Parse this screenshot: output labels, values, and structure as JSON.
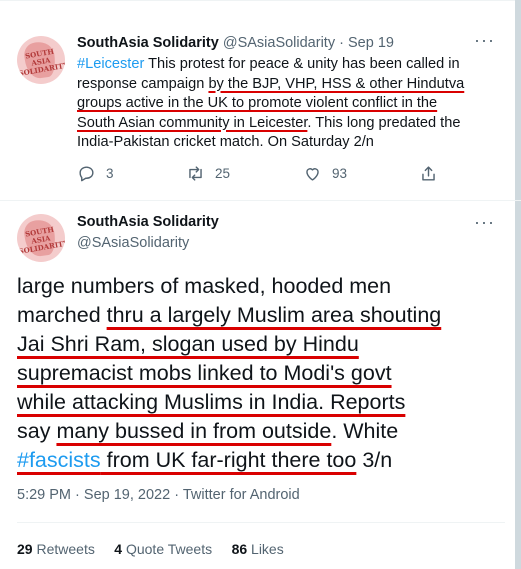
{
  "tweet1": {
    "avatar_text": "SOUTH ASIA SOLIDARITY",
    "name": "SouthAsia Solidarity",
    "handle": "@SAsiaSolidarity",
    "separator": "·",
    "date": "Sep 19",
    "more_icon": "more-dots-icon",
    "body": {
      "l1_tag": "#Leicester",
      "l1_text": " This protest for peace & unity has been called in",
      "l2_plain": "response campaign ",
      "l2_ul": "by the BJP, VHP, HSS & other Hindutva",
      "l3_ul": "groups active in the UK to promote violent conflict in the",
      "l4_ul": "South Asian community in Leicester",
      "l4_plain": ". This long predated the",
      "l5": "India-Pakistan cricket match. On Saturday 2/n"
    },
    "actions": {
      "replies": "3",
      "retweets": "25",
      "likes": "93"
    }
  },
  "tweet2": {
    "avatar_text": "SOUTH ASIA SOLIDARITY",
    "name": "SouthAsia Solidarity",
    "handle": "@SAsiaSolidarity",
    "more_icon": "more-dots-icon",
    "body": {
      "l1": "large numbers of masked, hooded  men",
      "l2_plain": "marched ",
      "l2_ul": "thru a largely Muslim area shouting",
      "l3_ul": "Jai Shri Ram, slogan used by Hindu",
      "l4_ul": "supremacist mobs linked to Modi's govt",
      "l5_ul": "while attacking Muslims in India. Reports",
      "l6_plain": "say ",
      "l6_ul": "many bussed in from outside",
      "l6_plain2": ". White",
      "l7_tag": "#fascists",
      "l7_ul": " from UK far-right there too",
      "l7_plain": " 3/n"
    },
    "time": "5:29 PM",
    "date": "Sep 19, 2022",
    "source": "Twitter for Android",
    "separator": "·",
    "stats": {
      "retweets_count": "29",
      "retweets_label": "Retweets",
      "quotes_count": "4",
      "quotes_label": "Quote Tweets",
      "likes_count": "86",
      "likes_label": "Likes"
    }
  },
  "colors": {
    "accent": "#1d9bf0",
    "muted": "#536471",
    "annotation_underline": "#d90000",
    "divider": "#eff3f4"
  }
}
